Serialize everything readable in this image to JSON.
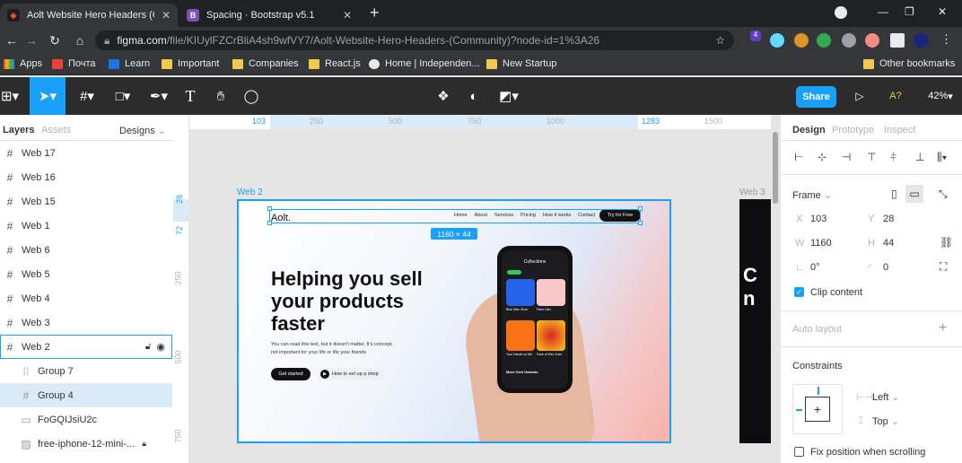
{
  "browser": {
    "tabs": [
      {
        "title": "Aolt Website Hero Headers (Com",
        "active": true
      },
      {
        "title": "Spacing · Bootstrap v5.1",
        "active": false
      }
    ],
    "new_tab": "+",
    "url_host": "figma.com",
    "url_path": "/file/KIUylFZCrBliA4sh9wfVY7/Aolt-Website-Hero-Headers-(Community)?node-id=1%3A26",
    "extension_badge": "4",
    "bookmarks": [
      "Apps",
      "Почта",
      "Learn",
      "Important",
      "Companies",
      "React.js",
      "Home | Independen...",
      "New Startup"
    ],
    "other_bookmarks": "Other bookmarks"
  },
  "toolbar": {
    "share_label": "Share",
    "help_label": "A?",
    "zoom": "42%"
  },
  "left_panel": {
    "tab_layers": "Layers",
    "tab_assets": "Assets",
    "page_select": "Designs",
    "layers": [
      {
        "name": "Web 17",
        "icon": "frame-hash-icon"
      },
      {
        "name": "Web 16",
        "icon": "frame-hash-icon"
      },
      {
        "name": "Web 15",
        "icon": "frame-hash-icon"
      },
      {
        "name": "Web 1",
        "icon": "frame-hash-icon"
      },
      {
        "name": "Web 6",
        "icon": "frame-hash-icon"
      },
      {
        "name": "Web 5",
        "icon": "frame-hash-icon"
      },
      {
        "name": "Web 4",
        "icon": "frame-hash-icon"
      },
      {
        "name": "Web 3",
        "icon": "frame-hash-icon"
      },
      {
        "name": "Web 2",
        "icon": "frame-hash-icon"
      },
      {
        "name": "Group 7",
        "icon": "group-icon"
      },
      {
        "name": "Group 4",
        "icon": "frame-hash-icon"
      },
      {
        "name": "FoGQIJsiU2c",
        "icon": "rectangle-icon"
      },
      {
        "name": "free-iphone-12-mini-...",
        "icon": "image-icon"
      }
    ]
  },
  "rulers": {
    "h": [
      "103",
      "250",
      "500",
      "750",
      "1000",
      "1283",
      "1500"
    ],
    "v": [
      "28",
      "72",
      "250",
      "500",
      "750"
    ]
  },
  "canvas": {
    "frame_label": "Web 2",
    "frame_label_right": "Web 3",
    "size_badge": "1160 × 44",
    "hero": {
      "logo": "Aolt.",
      "nav": [
        "Home",
        "About",
        "Services",
        "Pricing",
        "How it works",
        "Contact"
      ],
      "cta": "Try for Free",
      "headline": [
        "Helping you sell",
        "your products",
        "faster"
      ],
      "body": [
        "You can read this text, but it doesn't matter. It's concept,",
        "not important for your life or life your friends"
      ],
      "primary_button": "Get started",
      "secondary_button": "How to set up a shop",
      "phone": {
        "title": "Collections",
        "cards": [
          "Blue Nike Shoe",
          "Pairs Cart",
          "Your Hands on Me",
          "Face of Kiev Juan"
        ],
        "more": "More Grid Variants"
      }
    },
    "right_preview": {
      "letters": [
        "C",
        "n"
      ]
    }
  },
  "right_panel": {
    "tabs": [
      "Design",
      "Prototype",
      "Inspect"
    ],
    "frame_label": "Frame",
    "x_label": "X",
    "x": "103",
    "y_label": "Y",
    "y": "28",
    "w_label": "W",
    "w": "1160",
    "h_label": "H",
    "h": "44",
    "rotation": "0°",
    "radius": "0",
    "clip_content": "Clip content",
    "auto_layout": "Auto layout",
    "constraints": "Constraints",
    "constraint_h": "Left",
    "constraint_v": "Top",
    "fix_position": "Fix position when scrolling"
  },
  "colors": {
    "accent": "#18a0fb",
    "toolbar_bg": "#2c2c2c",
    "browser_bg": "#35363a"
  }
}
